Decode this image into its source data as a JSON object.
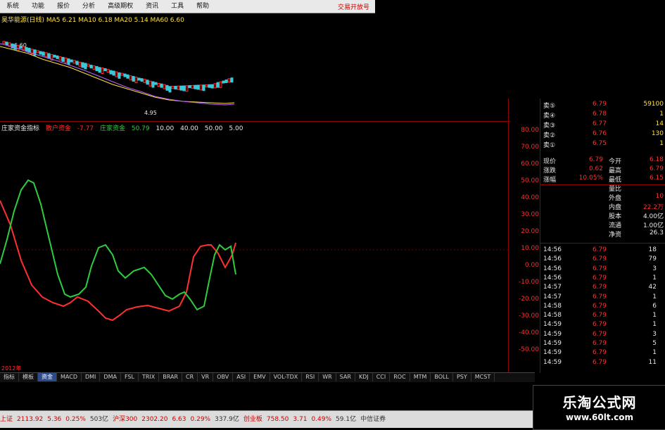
{
  "menu": {
    "items": [
      "系统",
      "功能",
      "报价",
      "分析",
      "高级期权",
      "资讯",
      "工具",
      "帮助"
    ],
    "right_label": "交易开放号"
  },
  "kline": {
    "info": "昊华能源(日线) MA5 6.21 MA10 6.18 MA20 5.14 MA60 6.60",
    "price_label": "6.60",
    "low_label": "4.95"
  },
  "indicator": {
    "title": "庄家资金指标",
    "items": [
      {
        "label": "散户资金",
        "value": "",
        "color": "#ff3030"
      },
      {
        "label": "-7.77",
        "value": "",
        "color": "#ff3030"
      },
      {
        "label": "庄家资金",
        "value": "",
        "color": "#2ecc40"
      },
      {
        "label": "50.79",
        "value": "",
        "color": "#2ecc40"
      },
      {
        "label": "10.00",
        "value": "",
        "color": "#e8e8e8"
      },
      {
        "label": "40.00",
        "value": "",
        "color": "#e8e8e8"
      },
      {
        "label": "50.00",
        "value": "",
        "color": "#e8e8e8"
      },
      {
        "label": "5.00",
        "value": "",
        "color": "#e8e8e8"
      }
    ],
    "series_colors": {
      "retail": "#ff3030",
      "main": "#2ecc40"
    }
  },
  "axis_labels": [
    "80.00",
    "70.00",
    "60.00",
    "50.00",
    "40.00",
    "30.00",
    "20.00",
    "10.00",
    "0.00",
    "-10.00",
    "-20.00",
    "-30.00",
    "-40.00",
    "-50.00"
  ],
  "order_book": [
    {
      "label": "卖⑤",
      "price": "6.79",
      "vol": "59100"
    },
    {
      "label": "卖④",
      "price": "6.78",
      "vol": "1"
    },
    {
      "label": "卖③",
      "price": "6.77",
      "vol": "14"
    },
    {
      "label": "卖②",
      "price": "6.76",
      "vol": "130"
    },
    {
      "label": "卖①",
      "price": "6.75",
      "vol": "1"
    }
  ],
  "quote": [
    {
      "label": "现价",
      "value": "6.79",
      "label2": "今开",
      "value2": "6.18"
    },
    {
      "label": "涨跌",
      "value": "0.62",
      "label2": "最高",
      "value2": "6.79"
    },
    {
      "label": "涨幅",
      "value": "10.05%",
      "label2": "最低",
      "value2": "6.15"
    },
    {
      "label": "",
      "value": "",
      "label2": "量比",
      "value2": ""
    },
    {
      "label": "",
      "value": "",
      "label2": "外盘",
      "value2": "10"
    },
    {
      "label": "",
      "value": "",
      "label2": "内盘",
      "value2": "22.2万"
    },
    {
      "label": "",
      "value": "",
      "label2": "股本",
      "value2": "4.00亿"
    },
    {
      "label": "",
      "value": "",
      "label2": "流通",
      "value2": "1.00亿"
    },
    {
      "label": "",
      "value": "",
      "label2": "净资",
      "value2": "26.3"
    }
  ],
  "ticks": [
    {
      "time": "14:56",
      "price": "6.79",
      "vol": "18"
    },
    {
      "time": "14:56",
      "price": "6.79",
      "vol": "79"
    },
    {
      "time": "14:56",
      "price": "6.79",
      "vol": "3"
    },
    {
      "time": "14:56",
      "price": "6.79",
      "vol": "1"
    },
    {
      "time": "14:57",
      "price": "6.79",
      "vol": "42"
    },
    {
      "time": "14:57",
      "price": "6.79",
      "vol": "1"
    },
    {
      "time": "14:58",
      "price": "6.79",
      "vol": "6"
    },
    {
      "time": "14:58",
      "price": "6.79",
      "vol": "1"
    },
    {
      "time": "14:59",
      "price": "6.79",
      "vol": "1"
    },
    {
      "time": "14:59",
      "price": "6.79",
      "vol": "3"
    },
    {
      "time": "14:59",
      "price": "6.79",
      "vol": "5"
    },
    {
      "time": "14:59",
      "price": "6.79",
      "vol": "1"
    },
    {
      "time": "14:59",
      "price": "6.79",
      "vol": "11"
    }
  ],
  "year_label": "2012年",
  "tabs": [
    "指标",
    "模板",
    "资金",
    "MACD",
    "DMI",
    "DMA",
    "FSL",
    "TRIX",
    "BRAR",
    "CR",
    "VR",
    "OBV",
    "ASI",
    "EMV",
    "VOL-TDX",
    "RSI",
    "WR",
    "SAR",
    "KDJ",
    "CCI",
    "ROC",
    "MTM",
    "BOLL",
    "PSY",
    "MCST"
  ],
  "status": [
    {
      "text": "上证",
      "color": "#c00"
    },
    {
      "text": "2113.92",
      "color": "#c00"
    },
    {
      "text": "5.36",
      "color": "#c00"
    },
    {
      "text": "0.25%",
      "color": "#c00"
    },
    {
      "text": "503亿",
      "color": "#333"
    },
    {
      "text": "沪深300",
      "color": "#c00"
    },
    {
      "text": "2302.20",
      "color": "#c00"
    },
    {
      "text": "6.63",
      "color": "#c00"
    },
    {
      "text": "0.29%",
      "color": "#c00"
    },
    {
      "text": "337.9亿",
      "color": "#333"
    },
    {
      "text": "创业板",
      "color": "#c00"
    },
    {
      "text": "758.50",
      "color": "#c00"
    },
    {
      "text": "3.71",
      "color": "#c00"
    },
    {
      "text": "0.49%",
      "color": "#c00"
    },
    {
      "text": "59.1亿",
      "color": "#333"
    },
    {
      "text": "中信证券",
      "color": "#333"
    }
  ],
  "watermark": {
    "line1": "乐淘公式网",
    "line2": "www.60lt.com"
  }
}
